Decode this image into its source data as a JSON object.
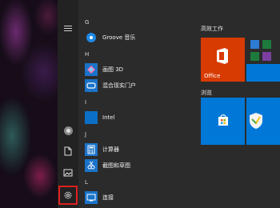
{
  "app_list": {
    "sections": [
      {
        "letter": "G",
        "apps": [
          {
            "name": "Groove 音乐",
            "icon": "groove-music-icon"
          }
        ]
      },
      {
        "letter": "H",
        "apps": [
          {
            "name": "画图 3D",
            "icon": "paint-3d-icon"
          },
          {
            "name": "混合现实门户",
            "icon": "mixed-reality-portal-icon"
          }
        ]
      },
      {
        "letter": "I",
        "apps": [
          {
            "name": "Intel",
            "icon": "intel-icon"
          }
        ]
      },
      {
        "letter": "J",
        "apps": [
          {
            "name": "计算器",
            "icon": "calculator-icon"
          },
          {
            "name": "截图和草图",
            "icon": "snip-sketch-icon"
          }
        ]
      },
      {
        "letter": "L",
        "apps": [
          {
            "name": "连接",
            "icon": "connect-icon"
          }
        ]
      }
    ]
  },
  "tiles": {
    "group1_title": "高效工作",
    "office_label": "Office",
    "group2_title": "浏览"
  },
  "colors": {
    "tile_blue": "#0078d7",
    "office_orange": "#d83b01",
    "highlight_red": "#e02020"
  }
}
